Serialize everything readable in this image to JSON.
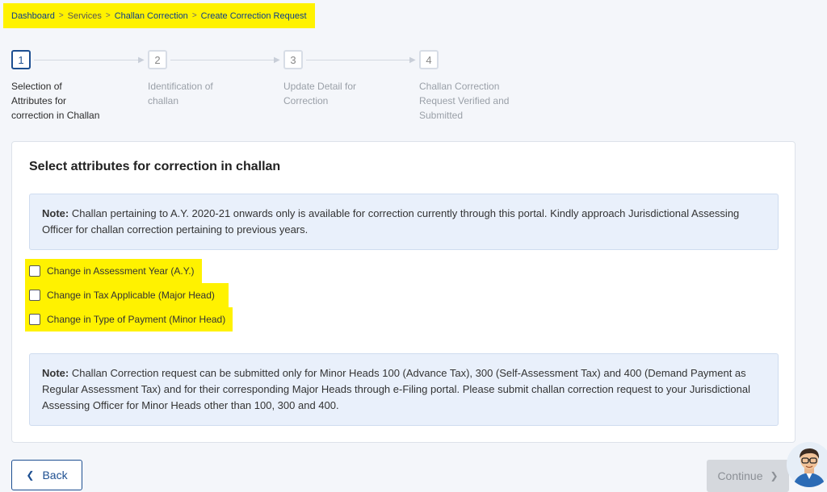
{
  "breadcrumb": {
    "items": [
      "Dashboard",
      "Services",
      "Challan Correction",
      "Create Correction Request"
    ],
    "separator": ">"
  },
  "stepper": {
    "steps": [
      {
        "number": "1",
        "label_lines": [
          "Selection of",
          "Attributes for",
          "correction in Challan"
        ],
        "active": true
      },
      {
        "number": "2",
        "label_lines": [
          "Identification of",
          "challan"
        ],
        "active": false
      },
      {
        "number": "3",
        "label_lines": [
          "Update Detail for",
          "Correction"
        ],
        "active": false
      },
      {
        "number": "4",
        "label_lines": [
          "Challan Correction",
          "Request Verified and",
          "Submitted"
        ],
        "active": false
      }
    ]
  },
  "card": {
    "title": "Select attributes for correction in challan",
    "note1": {
      "label": "Note:",
      "text": " Challan pertaining to A.Y. 2020-21 onwards only is available for correction currently through this portal. Kindly approach Jurisdictional Assessing Officer for challan correction pertaining to previous years."
    },
    "options": [
      {
        "label": "Change in Assessment Year (A.Y.)",
        "checked": false
      },
      {
        "label": "Change in Tax Applicable (Major Head)",
        "checked": false
      },
      {
        "label": "Change in Type of Payment (Minor Head)",
        "checked": false
      }
    ],
    "note2": {
      "label": "Note:",
      "text": " Challan Correction request can be submitted only for Minor Heads 100 (Advance Tax), 300 (Self-Assessment Tax) and 400 (Demand Payment as Regular Assessment Tax) and for their corresponding Major Heads through e-Filing portal. Please submit challan correction request to your Jurisdictional Assessing Officer for Minor Heads other than 100, 300 and 400."
    }
  },
  "buttons": {
    "back": "Back",
    "continue": "Continue",
    "back_icon": "chevron-left-icon",
    "continue_icon": "chevron-right-icon"
  },
  "colors": {
    "highlight": "#fff200",
    "primary": "#1d4f91",
    "note_bg": "#e9f0fb"
  }
}
